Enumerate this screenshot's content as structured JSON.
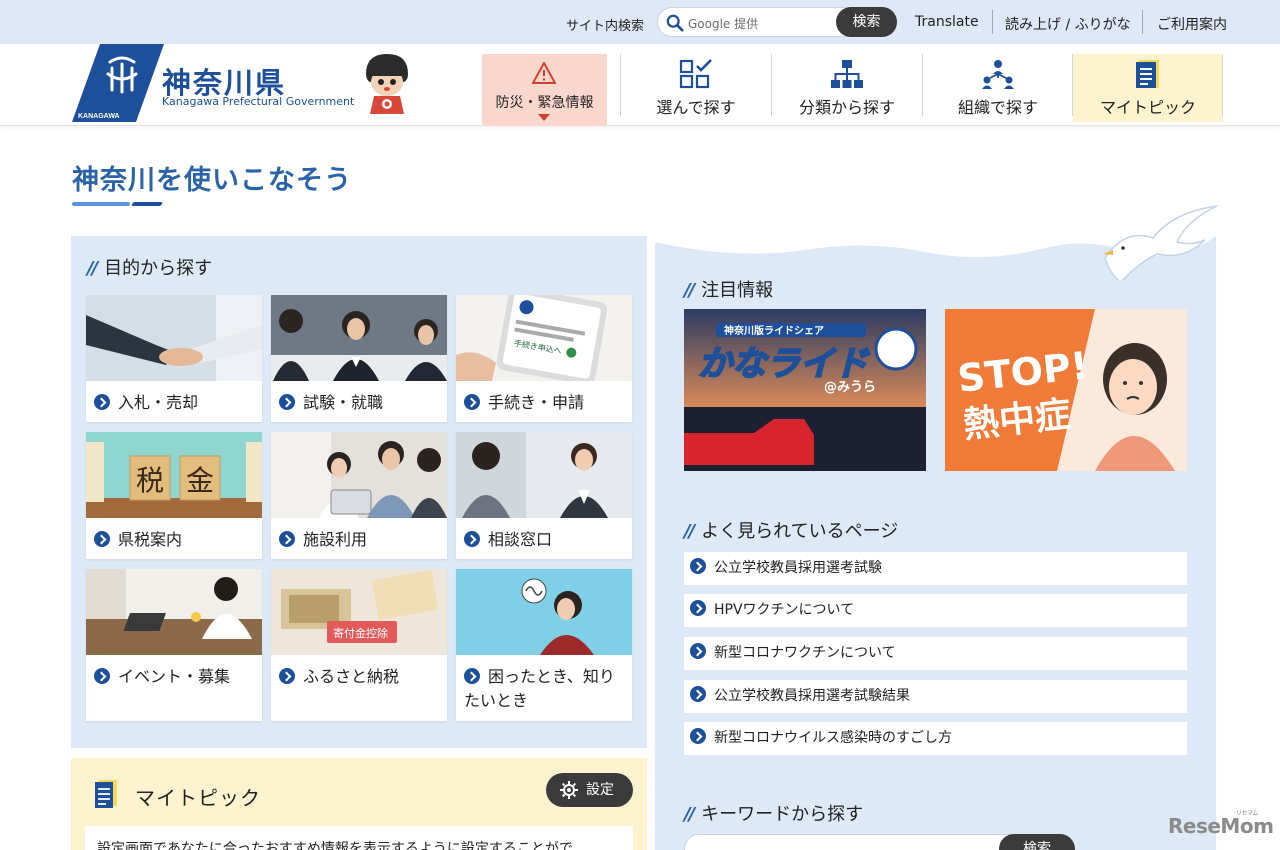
{
  "topbar": {
    "site_search_label": "サイト内検索",
    "search_placeholder": "Google 提供",
    "search_button": "検索",
    "translate": "Translate",
    "read_aloud": "読み上げ / ふりがな",
    "guide": "ご利用案内"
  },
  "header": {
    "logo_title": "神奈川県",
    "logo_subtitle": "Kanagawa Prefectural Government",
    "logo_badge": "KANAGAWA",
    "bousai": "防災・緊急情報",
    "nav": [
      {
        "label": "選んで探す",
        "icon": "checklist-icon"
      },
      {
        "label": "分類から探す",
        "icon": "hierarchy-icon"
      },
      {
        "label": "組織で探す",
        "icon": "organization-icon"
      },
      {
        "label": "マイトピック",
        "icon": "document-icon"
      }
    ]
  },
  "main": {
    "page_title": "神奈川を使いこなそう"
  },
  "purpose": {
    "heading": "目的から探す",
    "cards": [
      {
        "label": "入札・売却"
      },
      {
        "label": "試験・就職"
      },
      {
        "label": "手続き・申請",
        "img_text": "手続き申込へ"
      },
      {
        "label": "県税案内",
        "img_text_a": "税",
        "img_text_b": "金"
      },
      {
        "label": "施設利用"
      },
      {
        "label": "相談窓口"
      },
      {
        "label": "イベント・募集"
      },
      {
        "label": "ふるさと納税",
        "img_text": "寄付金控除"
      },
      {
        "label": "困ったとき、知りたいとき"
      }
    ]
  },
  "mytopic": {
    "title": "マイトピック",
    "settings_button": "設定",
    "description": "設定画面であなたに合ったおすすめ情報を表示するように設定することがで"
  },
  "attention": {
    "heading": "注目情報",
    "banners": [
      {
        "text_top": "神奈川版ライドシェア",
        "text_main": "かなライド",
        "text_sub": "@みうら"
      },
      {
        "text_top": "STOP!",
        "text_main": "熱中症"
      }
    ]
  },
  "popular": {
    "heading": "よく見られているページ",
    "items": [
      "公立学校教員採用選考試験",
      "HPVワクチンについて",
      "新型コロナワクチンについて",
      "公立学校教員採用選考試験結果",
      "新型コロナウイルス感染時のすごし方"
    ]
  },
  "keyword": {
    "heading": "キーワードから探す",
    "button": "検索"
  },
  "watermark": {
    "text": "ReseMom",
    "small": "リセマム"
  },
  "colors": {
    "brand_blue": "#1d4f9a",
    "accent_blue": "#2a63a8",
    "panel_blue": "#dde9f6",
    "topbar_bg": "#dfe8f8",
    "alert_pink": "#fad7cc",
    "mytopic_yellow": "#fdf3cf",
    "dark_button": "#3b3b3b"
  }
}
